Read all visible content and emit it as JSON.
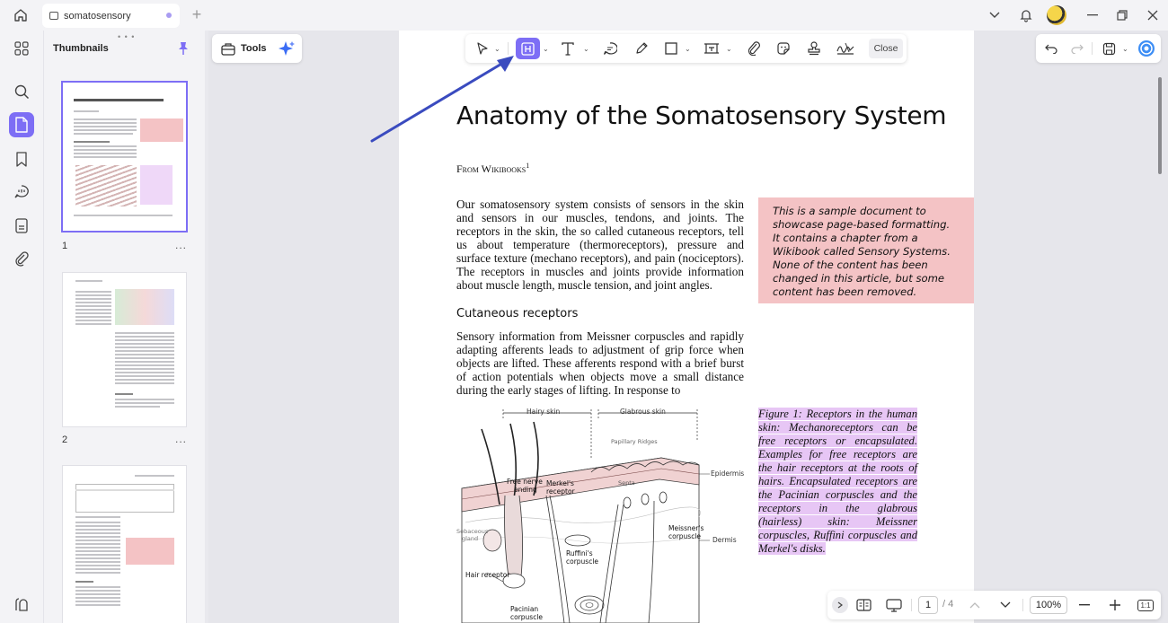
{
  "tab": {
    "title": "somatosensory"
  },
  "thumbnails": {
    "title": "Thumbnails",
    "pages": [
      "1",
      "2"
    ],
    "more": "..."
  },
  "tools": {
    "label": "Tools"
  },
  "annotation_toolbar": {
    "close_label": "Close"
  },
  "document": {
    "title": "Anatomy of the Somatosensory System",
    "from": "From Wikibooks",
    "footnote": "1",
    "intro": "Our somatosensory system consists of sensors in the skin and sensors in our muscles, tendons, and joints. The receptors in the skin, the so called cutaneous receptors, tell us about temperature (thermoreceptors), pressure and surface texture (mechano receptors), and pain (nociceptors). The receptors in muscles and joints provide information about muscle length, muscle tension, and joint angles.",
    "note": "This is a sample document to showcase page-based formatting. It contains a chapter from a Wikibook called Sensory Systems. None of the content has been changed in this article, but some content has been removed.",
    "section_heading": "Cutaneous receptors",
    "section_text": "Sensory information from Meissner corpuscles and rapidly adapting afferents leads to adjustment of grip force when objects are lifted. These afferents respond with a brief burst of action potentials when objects move a small distance during the early stages of lifting. In response to",
    "figure_caption": "Figure 1: Receptors in the human skin: Mechanoreceptors can be free receptors or encapsulated. Examples for free receptors are the hair receptors at the roots of hairs. Encapsulated receptors are the Pacinian corpuscles and the receptors in the glabrous (hairless) skin: Meissner corpuscles, Ruffini corpuscles and Merkel's disks.",
    "figure_labels": {
      "hairy_skin": "Hairy skin",
      "glabrous_skin": "Glabrous skin",
      "papillary_ridges": "Papillary Ridges",
      "free_nerve": "Free nerve",
      "ending": "ending",
      "merkels": "Merkel's",
      "receptor": "receptor",
      "septa": "Septa",
      "epidermis": "Epidermis",
      "sebaceous": "Sebaceous",
      "gland": "gland",
      "meissners": "Meissner's",
      "corpuscle": "corpuscle",
      "dermis": "Dermis",
      "ruffinis": "Ruffini's",
      "ruffini_corpuscle": "corpuscle",
      "hair_receptor": "Hair receptor",
      "pacinian": "Pacinian",
      "pacinian_corpuscle": "corpuscle"
    }
  },
  "navigation": {
    "current_page": "1",
    "total_pages": "/ 4",
    "zoom": "100%",
    "fit_label": "1:1"
  },
  "colors": {
    "accent": "#7d6ef5",
    "note_bg": "#f4c3c5",
    "caption_highlight": "#e7c6f5",
    "arrow": "#3a4bbf"
  }
}
